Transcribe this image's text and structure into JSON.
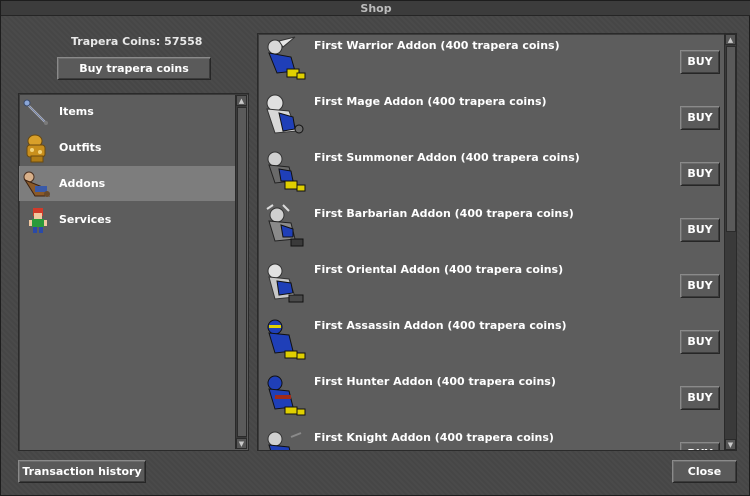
{
  "window": {
    "title": "Shop"
  },
  "coins": {
    "label": "Trapera Coins: 57558"
  },
  "buy_coins_label": "Buy trapera coins",
  "categories": [
    {
      "label": "Items",
      "icon": "wand-icon"
    },
    {
      "label": "Outfits",
      "icon": "golden-armor-icon"
    },
    {
      "label": "Addons",
      "icon": "addon-outfit-icon",
      "selected": true
    },
    {
      "label": "Services",
      "icon": "character-icon"
    }
  ],
  "offers": [
    {
      "label": "First Warrior Addon (400 trapera coins)",
      "buy_label": "BUY",
      "icon": "warrior-outfit-icon"
    },
    {
      "label": "First Mage Addon (400 trapera coins)",
      "buy_label": "BUY",
      "icon": "mage-outfit-icon"
    },
    {
      "label": "First Summoner Addon (400 trapera coins)",
      "buy_label": "BUY",
      "icon": "summoner-outfit-icon"
    },
    {
      "label": "First Barbarian Addon (400 trapera coins)",
      "buy_label": "BUY",
      "icon": "barbarian-outfit-icon"
    },
    {
      "label": "First Oriental Addon (400 trapera coins)",
      "buy_label": "BUY",
      "icon": "oriental-outfit-icon"
    },
    {
      "label": "First Assassin Addon (400 trapera coins)",
      "buy_label": "BUY",
      "icon": "assassin-outfit-icon"
    },
    {
      "label": "First Hunter Addon (400 trapera coins)",
      "buy_label": "BUY",
      "icon": "hunter-outfit-icon"
    },
    {
      "label": "First Knight Addon (400 trapera coins)",
      "buy_label": "BUY",
      "icon": "knight-outfit-icon"
    }
  ],
  "footer": {
    "transaction_history_label": "Transaction history",
    "close_label": "Close"
  },
  "colors": {
    "window_bg": "#474747",
    "panel_bg": "#5d5d5d",
    "selected_bg": "#7d7d7d",
    "outfit_blue": "#1f3fb8",
    "outfit_yellow": "#e0d000"
  }
}
